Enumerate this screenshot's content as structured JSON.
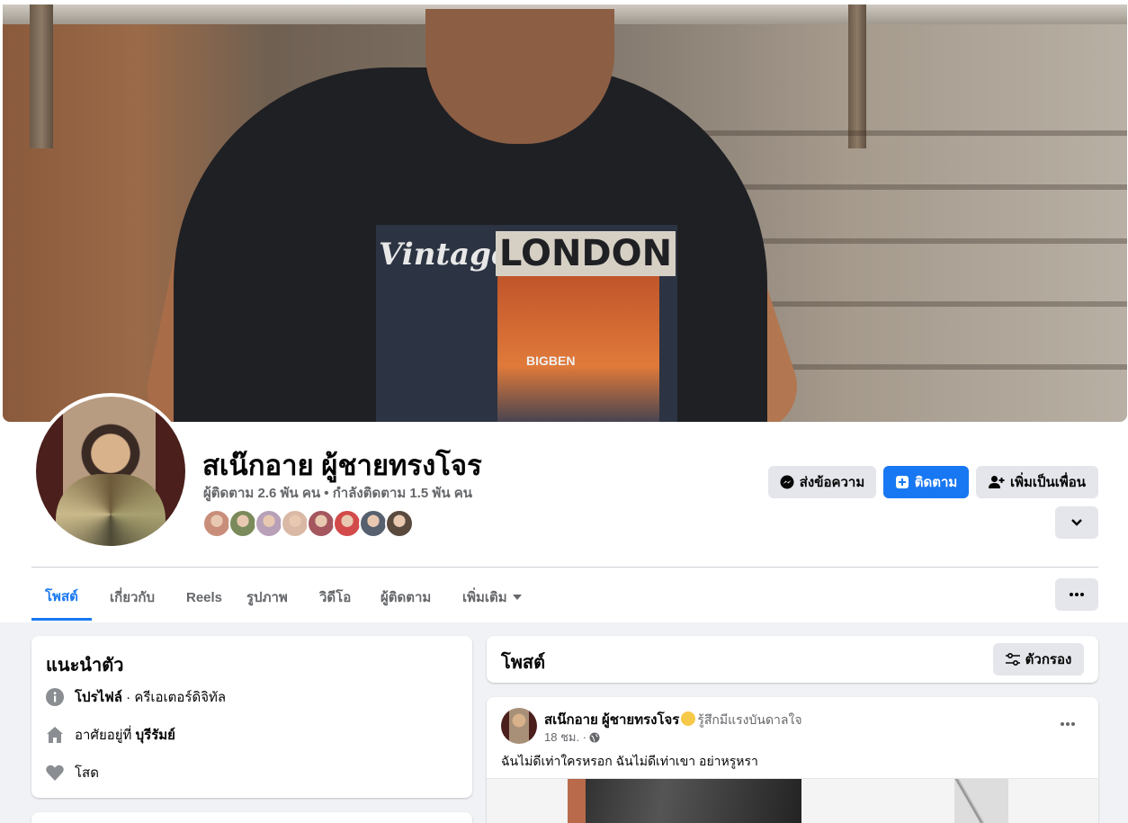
{
  "profile": {
    "name": "สเน๊กอาย ผู้ชายทรงโจร",
    "stats": "ผู้ติดตาม 2.6 พัน คน • กำลังติดตาม 1.5 พัน คน",
    "cover_shirt_text": "Vintage",
    "cover_shirt_text2": "LONDON",
    "cover_shirt_text3": "BIGBEN",
    "friend_colors": [
      "#c98e7a",
      "#7a8a5a",
      "#b7a0b8",
      "#d9b9a6",
      "#a5565e",
      "#d24a4a",
      "#56606e",
      "#5a4a3e"
    ]
  },
  "actions": {
    "message_label": "ส่งข้อความ",
    "follow_label": "ติดตาม",
    "add_friend_label": "เพิ่มเป็นเพื่อน"
  },
  "tabs": [
    {
      "label": "โพสต์",
      "active": true
    },
    {
      "label": "เกี่ยวกับ"
    },
    {
      "label": "Reels"
    },
    {
      "label": "รูปภาพ"
    },
    {
      "label": "วิดีโอ"
    },
    {
      "label": "ผู้ติดตาม"
    },
    {
      "label": "เพิ่มเติม"
    }
  ],
  "intro": {
    "title": "แนะนำตัว",
    "profile_label": "โปรไฟล์",
    "profile_value": " · ครีเอเตอร์ดิจิทัล",
    "lives_prefix": "อาศัยอยู่ที่ ",
    "lives_city": "บุรีรัมย์",
    "relationship": "โสด"
  },
  "posts": {
    "title": "โพสต์",
    "filter_label": "ตัวกรอง",
    "first": {
      "author": "สเน๊กอาย ผู้ชายทรงโจร",
      "feeling": "รู้สึกมีแรงบันดาลใจ",
      "time": "18 ชม. ·",
      "text": "ฉันไม่ดีเท่าใครหรอก ฉันไม่ดีเท่าเขา อย่าหรูหรา"
    }
  },
  "colors": {
    "accent": "#1877f2",
    "background": "#f0f2f5",
    "secondary_text": "#65676b"
  }
}
